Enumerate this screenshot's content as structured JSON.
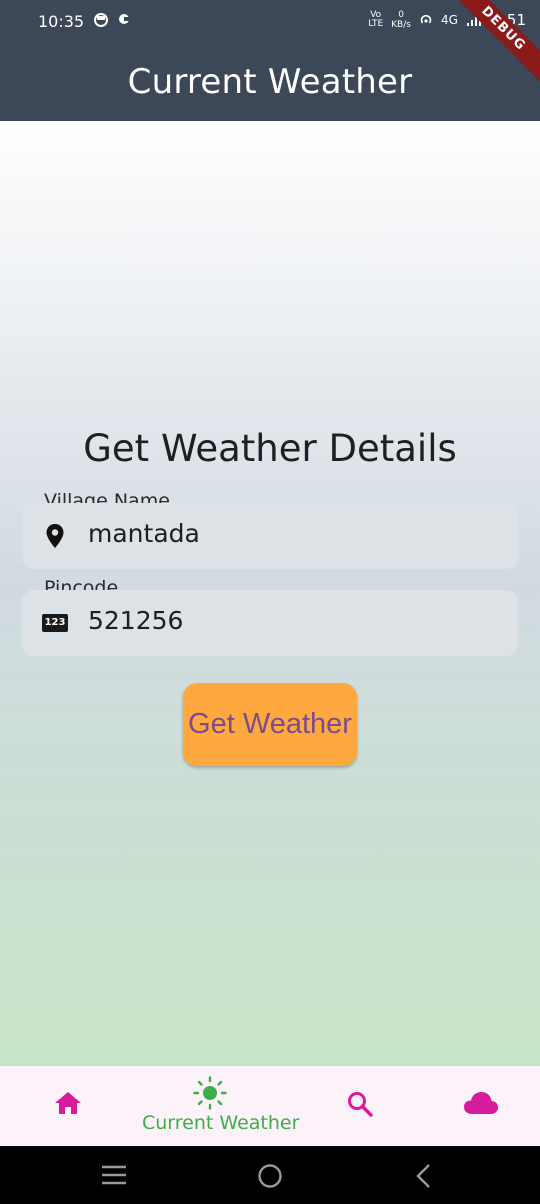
{
  "status_bar": {
    "time": "10:35",
    "net_speed_value": "0",
    "net_speed_unit": "KB/s",
    "network_type": "4G",
    "battery": "51"
  },
  "app_bar": {
    "title": "Current Weather"
  },
  "debug_banner": "DEBUG",
  "form": {
    "heading": "Get Weather Details",
    "village": {
      "label": "Village Name",
      "value": "mantada",
      "icon": "location-pin-icon"
    },
    "pincode": {
      "label": "Pincode",
      "value": "521256",
      "icon": "numbers-icon",
      "icon_text": "123"
    },
    "submit_label": "Get Weather"
  },
  "bottom_nav": {
    "items": [
      {
        "icon": "home-icon",
        "label": ""
      },
      {
        "icon": "sun-icon",
        "label": "Current Weather"
      },
      {
        "icon": "search-icon",
        "label": ""
      },
      {
        "icon": "cloud-icon",
        "label": ""
      }
    ],
    "selected_index": 1
  },
  "colors": {
    "app_bar": "#3c4858",
    "button": "#ffa83f",
    "button_text": "#7a4e8e",
    "nav_icon": "#d81b9c",
    "nav_selected": "#3fae4a"
  }
}
